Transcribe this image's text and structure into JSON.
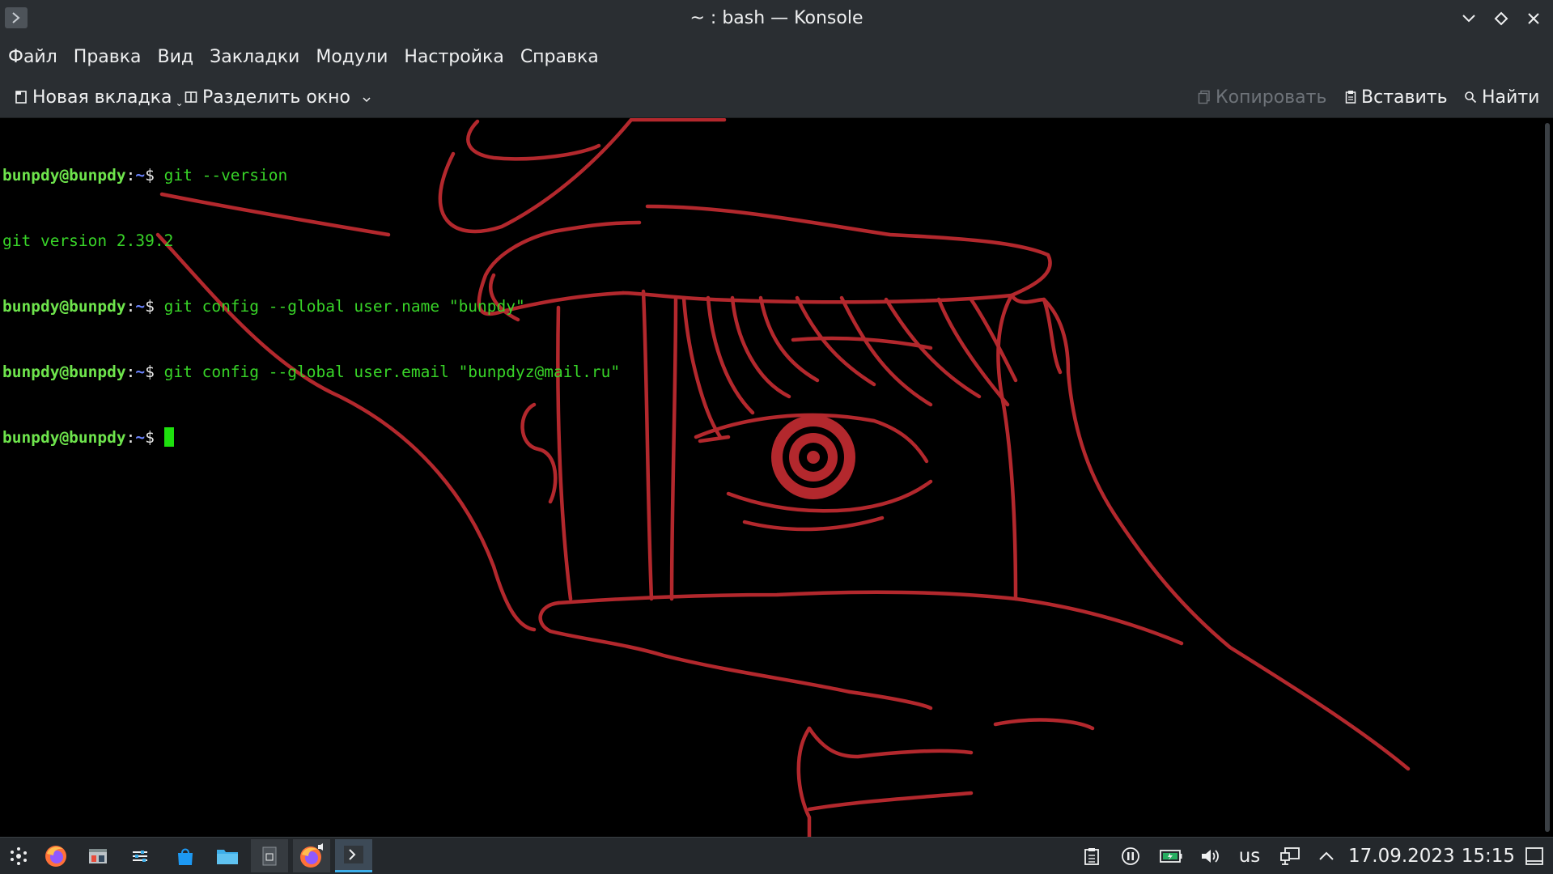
{
  "window": {
    "title": "~ : bash — Konsole"
  },
  "menubar": {
    "items": [
      "Файл",
      "Правка",
      "Вид",
      "Закладки",
      "Модули",
      "Настройка",
      "Справка"
    ]
  },
  "toolbar": {
    "new_tab": "Новая вкладка",
    "split_view": "Разделить окно",
    "copy": "Копировать",
    "paste": "Вставить",
    "find": "Найти"
  },
  "terminal": {
    "user": "bunpdy@bunpdy",
    "path": "~",
    "symbol": "$",
    "lines": [
      {
        "type": "prompt",
        "command": "git --version"
      },
      {
        "type": "output",
        "text": "git version 2.39.2"
      },
      {
        "type": "prompt",
        "command": "git config --global user.name \"bunpdy\""
      },
      {
        "type": "prompt",
        "command": "git config --global user.email \"bunpdyz@mail.ru\""
      },
      {
        "type": "prompt",
        "command": ""
      }
    ]
  },
  "taskbar": {
    "keyboard_layout": "us",
    "date": "17.09.2023",
    "time": "15:15"
  },
  "colors": {
    "chrome_bg": "#2a2e32",
    "terminal_bg": "#000000",
    "prompt_green": "#6ee44c",
    "path_blue": "#6b84ff",
    "art_red": "#b3282d",
    "accent": "#3daee9"
  },
  "icons": {
    "app": "konsole-prompt-icon",
    "minimize": "chevron-down-icon",
    "maximize": "diamond-icon",
    "close": "close-icon"
  }
}
